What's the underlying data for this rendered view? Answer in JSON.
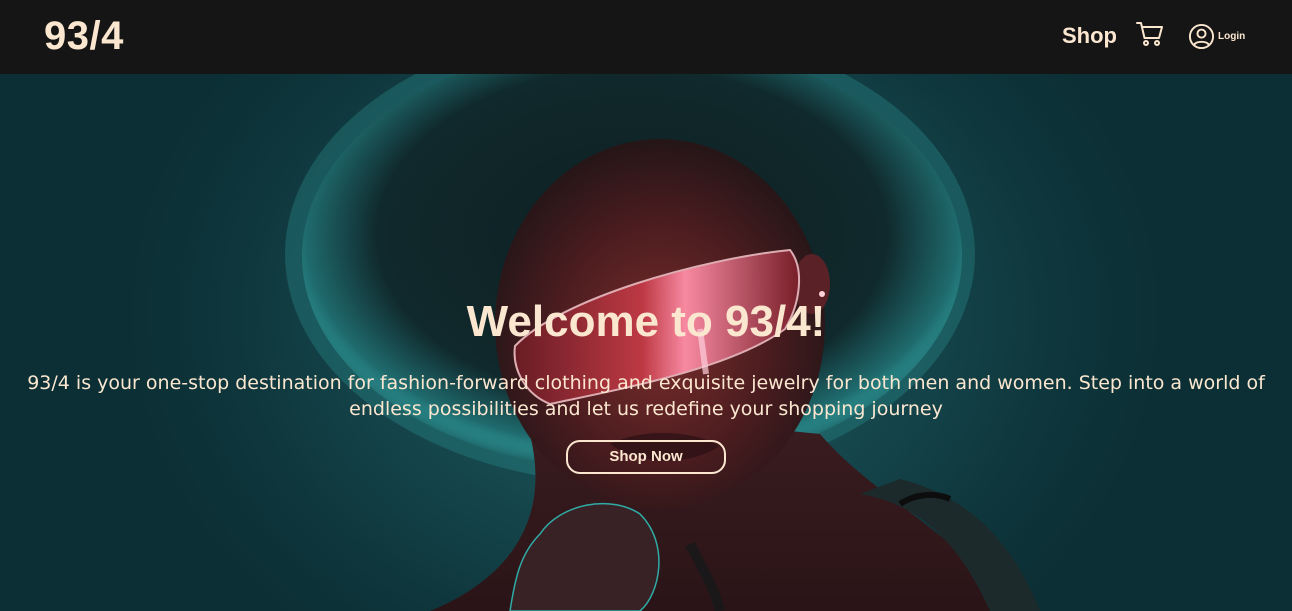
{
  "navbar": {
    "logo": "93/4",
    "shop_label": "Shop",
    "login_label": "Login"
  },
  "hero": {
    "title": "Welcome to 93/4!",
    "description": "93/4 is your one-stop destination for fashion-forward clothing and exquisite jewelry for both men and women. Step into a world of endless possibilities and let us redefine your shopping journey",
    "button_label": "Shop Now"
  },
  "icons": {
    "cart": "shopping-cart-icon",
    "user": "user-circle-icon"
  },
  "colors": {
    "navbar_bg": "#151515",
    "accent_text": "#fbe7d0",
    "hero_teal": "#16494f",
    "neon_red": "#d6404a",
    "neon_cyan": "#3fd6d0"
  }
}
